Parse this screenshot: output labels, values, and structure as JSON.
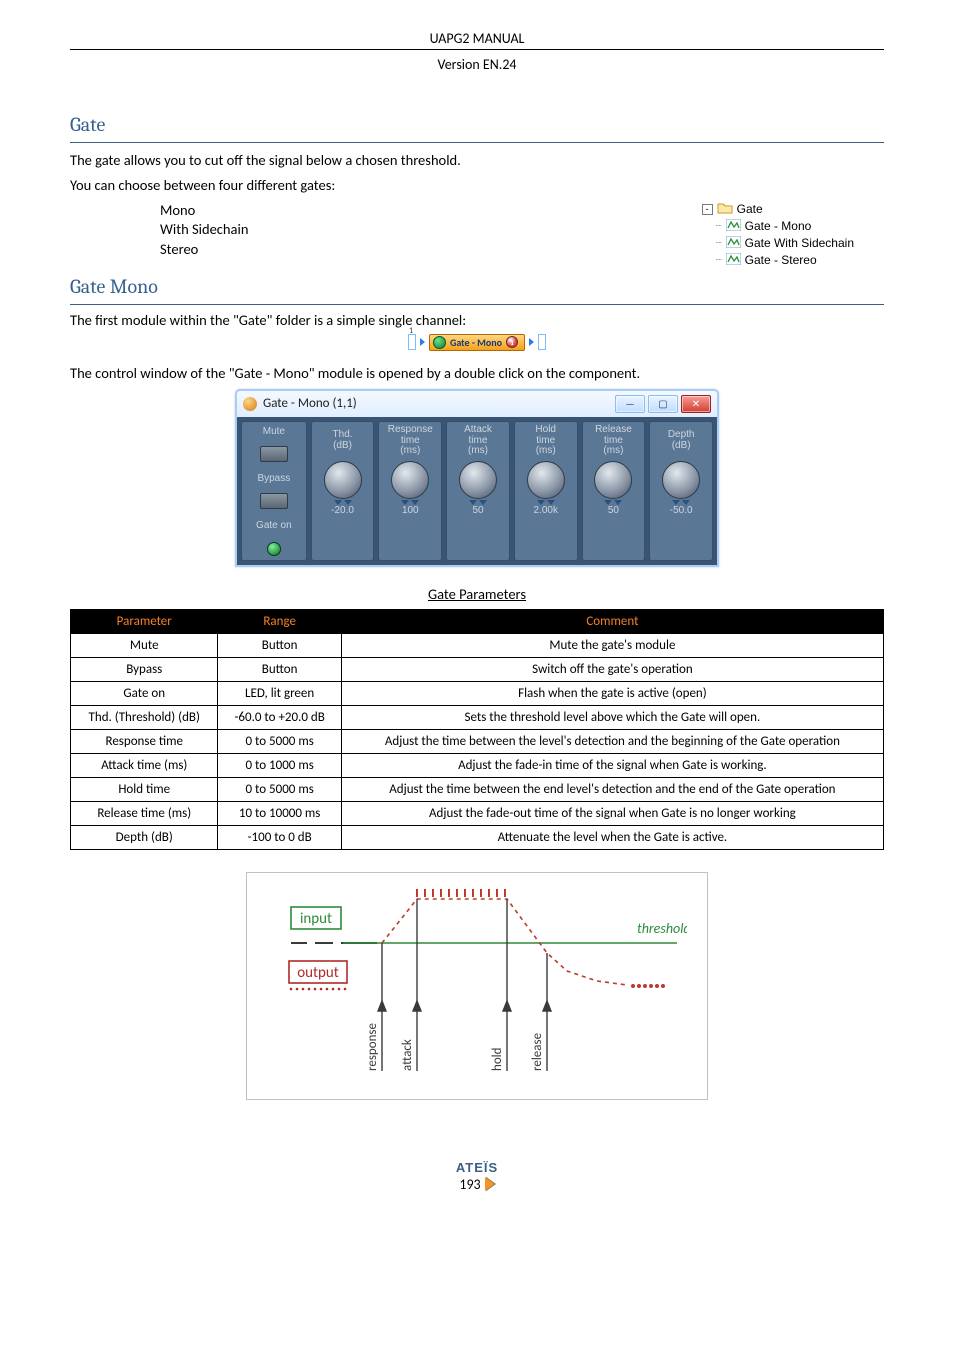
{
  "header": {
    "title": "UAPG2  MANUAL",
    "version": "Version EN.24"
  },
  "sections": {
    "gate": {
      "title": "Gate",
      "intro_line1": "The gate allows you to cut off the signal below a chosen threshold.",
      "intro_line2": "You can choose between four different gates:",
      "list": [
        "Mono",
        "With Sidechain",
        "Stereo"
      ]
    },
    "gate_mono": {
      "title": "Gate Mono",
      "line1_pre": "The first module within the \"Gate\" folder is a simple single channel:",
      "line2": "The control window of the \"Gate - Mono\" module is opened by a double click on the component."
    }
  },
  "tree": {
    "root": "Gate",
    "children": [
      "Gate - Mono",
      "Gate With Sidechain",
      "Gate - Stereo"
    ]
  },
  "chip": {
    "label": "Gate - Mono",
    "pill": "1"
  },
  "window": {
    "title": "Gate - Mono (1,1)",
    "side": {
      "mute": "Mute",
      "bypass": "Bypass",
      "gate_on": "Gate on"
    },
    "knobs": [
      {
        "label": "Thd.\n(dB)",
        "value": "-20.0"
      },
      {
        "label": "Response\ntime\n(ms)",
        "value": "100"
      },
      {
        "label": "Attack\ntime\n(ms)",
        "value": "50"
      },
      {
        "label": "Hold\ntime\n(ms)",
        "value": "2.00k"
      },
      {
        "label": "Release\ntime\n(ms)",
        "value": "50"
      },
      {
        "label": "Depth\n(dB)",
        "value": "-50.0"
      }
    ]
  },
  "table": {
    "caption": "Gate Parameters",
    "headers": [
      "Parameter",
      "Range",
      "Comment"
    ],
    "rows": [
      [
        "Mute",
        "Button",
        "Mute the gate's module"
      ],
      [
        "Bypass",
        "Button",
        "Switch off the gate's operation"
      ],
      [
        "Gate on",
        "LED, lit green",
        "Flash when the gate is active (open)"
      ],
      [
        "Thd. (Threshold)  (dB)",
        "-60.0 to +20.0 dB",
        "Sets the threshold level above which the Gate will open."
      ],
      [
        "Response time",
        "0 to 5000 ms",
        "Adjust the time between the level's detection and the beginning of the Gate operation"
      ],
      [
        "Attack time (ms)",
        "0 to 1000 ms",
        "Adjust the fade-in time of the signal when Gate is working."
      ],
      [
        "Hold time",
        "0 to 5000 ms",
        "Adjust the time between the end level's detection and the end of the Gate operation"
      ],
      [
        "Release time (ms)",
        "10 to 10000 ms",
        "Adjust the fade-out time of the signal when Gate is no longer working"
      ],
      [
        "Depth (dB)",
        "-100 to 0 dB",
        "Attenuate the level when the Gate is active."
      ]
    ]
  },
  "diagram": {
    "ticks_red": "' ' ' ' ' ' ' ' ' ' ' '",
    "input": "input",
    "output": "output",
    "threshold": "threshold",
    "axes": [
      "response",
      "attack",
      "hold",
      "release"
    ]
  },
  "footer": {
    "brand": "ATEÏS",
    "page": "193"
  }
}
